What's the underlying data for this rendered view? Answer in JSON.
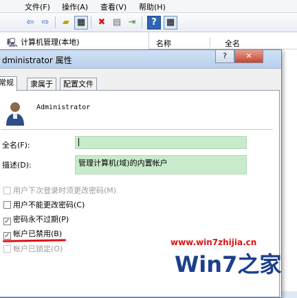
{
  "menu": [
    "文件(F)",
    "操作(A)",
    "查看(V)",
    "帮助(H)"
  ],
  "toolbar": {
    "icons": [
      "back-arrow-icon",
      "forward-arrow-icon",
      "up-folder-icon",
      "show-hide-tree-icon",
      "delete-icon",
      "properties-icon",
      "export-list-icon",
      "help-icon",
      "console-view-icon"
    ]
  },
  "tree": {
    "root_label": "计算机管理(本地)"
  },
  "list": {
    "col_name": "名称",
    "col_fullname": "全名"
  },
  "dialog": {
    "title": "dministrator 属性",
    "tabs": [
      "常规",
      "隶属于",
      "配置文件"
    ],
    "username": "Administrator",
    "fullname_label": "全名(F):",
    "fullname_value": "",
    "description_label": "描述(D):",
    "description_value": "管理计算机(域)的内置帐户",
    "checkboxes": [
      {
        "label": "用户下次登录时须更改密码(M)",
        "checked": false,
        "disabled": true
      },
      {
        "label": "用户不能更改密码(C)",
        "checked": false,
        "disabled": false
      },
      {
        "label": "密码永不过期(P)",
        "checked": true,
        "disabled": false
      },
      {
        "label": "帐户已禁用(B)",
        "checked": true,
        "disabled": false
      },
      {
        "label": "帐户已锁定(O)",
        "checked": false,
        "disabled": true
      }
    ]
  },
  "watermark": {
    "url": "www.win7zhijia.cn",
    "logo_text": "Win7之家"
  },
  "colors": {
    "field_bg": "#c8ebcb",
    "highlight_line": "#e0101a",
    "watermark_red": "#e01010",
    "watermark_blue": "#1c3f8e"
  }
}
